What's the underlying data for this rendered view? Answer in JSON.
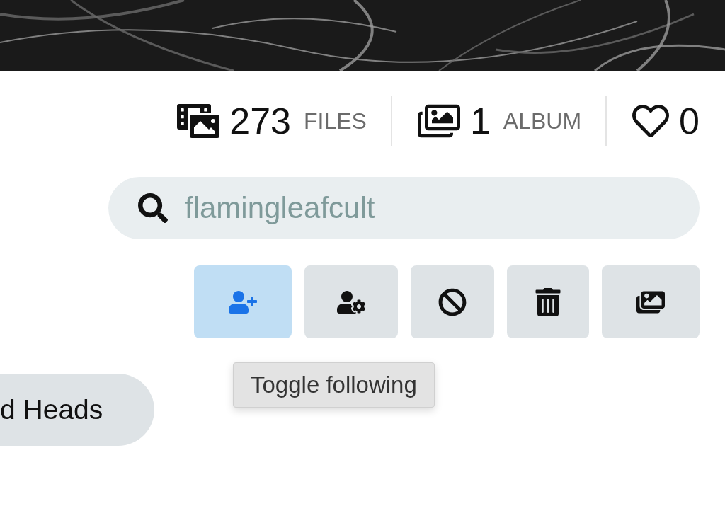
{
  "stats": [
    {
      "kind": "files",
      "count": "273",
      "label": "FILES"
    },
    {
      "kind": "album",
      "count": "1",
      "label": "ALBUM"
    },
    {
      "kind": "likes",
      "count": "0"
    }
  ],
  "search": {
    "value": "flamingleafcult"
  },
  "actions": [
    {
      "kind": "follow",
      "selected": true
    },
    {
      "kind": "manage",
      "selected": false
    },
    {
      "kind": "block",
      "selected": false
    },
    {
      "kind": "delete",
      "selected": false
    },
    {
      "kind": "gallery",
      "selected": false
    }
  ],
  "tooltip": {
    "text": "Toggle following"
  },
  "tag": {
    "label": "d Heads"
  }
}
